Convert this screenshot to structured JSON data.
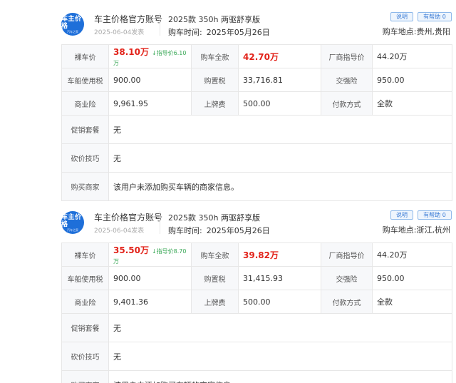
{
  "cards": [
    {
      "avatar_text": "车主价格",
      "avatar_sub": "汽车之家",
      "account": "车主价格官方账号",
      "post_date": "2025-06-04发表",
      "model": "2025款 350h 两驱舒享版",
      "buy_time_label": "购车时间:",
      "buy_time_value": "2025年05月26日",
      "explain_label": "说明",
      "help_label": "有帮助 0",
      "location_label": "购车地点:",
      "location_value": "贵州,贵阳",
      "bare_price_label": "裸车价",
      "bare_price": "38.10万",
      "guide_diff": "↓指导价6.10万",
      "total_label": "购车全款",
      "total": "42.70万",
      "msrp_label": "厂商指导价",
      "msrp": "44.20万",
      "vehicle_tax_label": "车船使用税",
      "vehicle_tax": "900.00",
      "purchase_tax_label": "购置税",
      "purchase_tax": "33,716.81",
      "compulsory_label": "交强险",
      "compulsory": "950.00",
      "commercial_label": "商业险",
      "commercial": "9,961.95",
      "plate_label": "上牌费",
      "plate": "500.00",
      "payment_label": "付款方式",
      "payment": "全款",
      "promo_label": "促销套餐",
      "promo": "无",
      "bargain_label": "砍价技巧",
      "bargain": "无",
      "dealer_label": "购买商家",
      "dealer": "该用户未添加购买车辆的商家信息。"
    },
    {
      "avatar_text": "车主价格",
      "avatar_sub": "汽车之家",
      "account": "车主价格官方账号",
      "post_date": "2025-06-04发表",
      "model": "2025款 350h 两驱舒享版",
      "buy_time_label": "购车时间:",
      "buy_time_value": "2025年05月26日",
      "explain_label": "说明",
      "help_label": "有帮助 0",
      "location_label": "购车地点:",
      "location_value": "浙江,杭州",
      "bare_price_label": "裸车价",
      "bare_price": "35.50万",
      "guide_diff": "↓指导价8.70万",
      "total_label": "购车全款",
      "total": "39.82万",
      "msrp_label": "厂商指导价",
      "msrp": "44.20万",
      "vehicle_tax_label": "车船使用税",
      "vehicle_tax": "900.00",
      "purchase_tax_label": "购置税",
      "purchase_tax": "31,415.93",
      "compulsory_label": "交强险",
      "compulsory": "950.00",
      "commercial_label": "商业险",
      "commercial": "9,401.36",
      "plate_label": "上牌费",
      "plate": "500.00",
      "payment_label": "付款方式",
      "payment": "全款",
      "promo_label": "促销套餐",
      "promo": "无",
      "bargain_label": "砍价技巧",
      "bargain": "无",
      "dealer_label": "购买商家",
      "dealer": "该用户未添加购买车辆的商家信息。"
    }
  ],
  "colors": {
    "accent": "#1e6fd9",
    "price_red": "#e2231a",
    "guide_green": "#3aa857"
  }
}
